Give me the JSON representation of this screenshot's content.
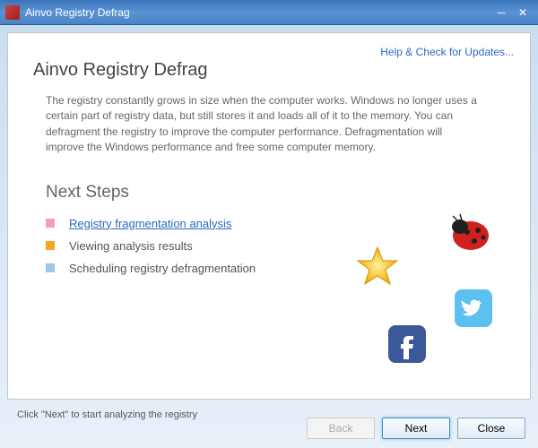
{
  "window": {
    "title": "Ainvo Registry Defrag"
  },
  "header": {
    "help_link": "Help & Check for Updates..."
  },
  "main": {
    "heading": "Ainvo Registry Defrag",
    "description": "The registry constantly grows in size when the computer works. Windows no longer uses a certain part of registry data, but still stores it and loads all of it to the memory. You can defragment the registry to improve the computer performance. Defragmentation will improve the Windows performance and free some computer memory.",
    "next_steps_heading": "Next Steps",
    "steps": [
      {
        "label": "Registry fragmentation analysis",
        "link": true
      },
      {
        "label": "Viewing analysis results",
        "link": false
      },
      {
        "label": "Scheduling registry defragmentation",
        "link": false
      }
    ]
  },
  "hint": "Click \"Next\" to start analyzing the registry",
  "buttons": {
    "back": "Back",
    "next": "Next",
    "close": "Close"
  },
  "decor": {
    "ladybug": "ladybug-icon",
    "star": "star-icon",
    "facebook": "facebook-icon",
    "twitter": "twitter-icon"
  }
}
